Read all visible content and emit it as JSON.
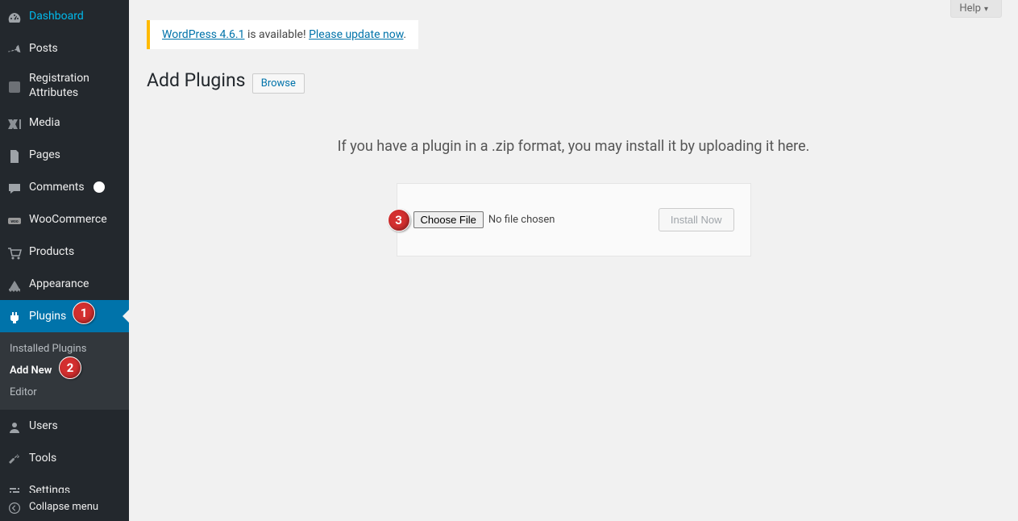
{
  "help_button": "Help",
  "update_nag": {
    "prefix_link": "WordPress 4.6.1",
    "middle_text": " is available! ",
    "action_link": "Please update now",
    "suffix": "."
  },
  "page": {
    "title": "Add Plugins",
    "browse_button": "Browse",
    "upload_description": "If you have a plugin in a .zip format, you may install it by uploading it here.",
    "choose_file": "Choose File",
    "file_status": "No file chosen",
    "install_now": "Install Now"
  },
  "sidebar": {
    "items": [
      {
        "label": "Dashboard",
        "icon": "dashboard"
      },
      {
        "label": "Posts",
        "icon": "pin"
      },
      {
        "label": "Registration Attributes",
        "icon": "registration"
      },
      {
        "label": "Media",
        "icon": "media"
      },
      {
        "label": "Pages",
        "icon": "pages"
      },
      {
        "label": "Comments",
        "icon": "comments"
      },
      {
        "label": "WooCommerce",
        "icon": "woo"
      },
      {
        "label": "Products",
        "icon": "products"
      },
      {
        "label": "Appearance",
        "icon": "appearance"
      },
      {
        "label": "Plugins",
        "icon": "plugins"
      },
      {
        "label": "Users",
        "icon": "users"
      },
      {
        "label": "Tools",
        "icon": "tools"
      },
      {
        "label": "Settings",
        "icon": "settings"
      }
    ],
    "submenu": [
      {
        "label": "Installed Plugins"
      },
      {
        "label": "Add New"
      },
      {
        "label": "Editor"
      }
    ],
    "collapse": "Collapse menu"
  },
  "annotations": {
    "badge1": "1",
    "badge2": "2",
    "badge3": "3"
  }
}
